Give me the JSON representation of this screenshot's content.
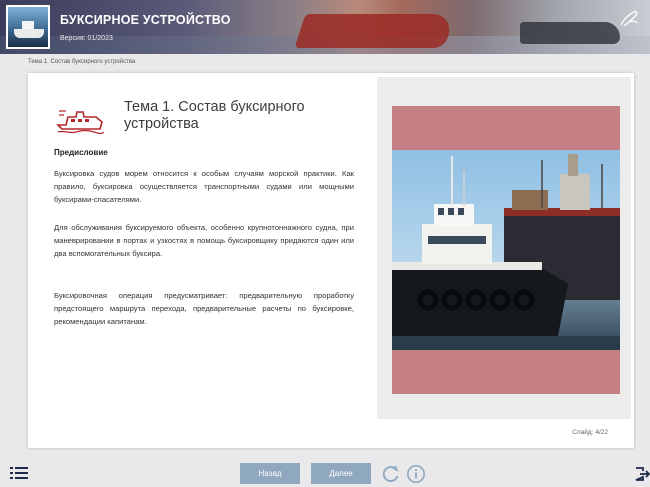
{
  "header": {
    "title": "БУКСИРНОЕ УСТРОЙСТВО",
    "version": "Версия: 01/2023",
    "logo_icon": "tugboat-logo-icon",
    "corner_icon": "signature-icon"
  },
  "breadcrumb": "Тема 1. Состав буксирного устройства",
  "content": {
    "topic_icon": "tugboat-icon",
    "topic_title": "Тема 1. Состав буксирного устройства",
    "section_title": "Предисловие",
    "paragraphs": [
      "Буксировка судов морем относится к особым случаям морской практики. Как правило, буксировка осуществляется транспортными судами или мощными буксирами-спасателями.",
      "Для обслуживания буксируемого объекта, особенно крупнотоннажного судна, при маневрировании в портах и узкостях в помощь буксировщику придаются один или два вспомогательных буксира.",
      "Буксировочная операция предусматривает: предварительную проработку предстоящего маршрута перехода, предварительные расчеты по буксировке, рекомендации капитанам."
    ],
    "image": "tugboat-photo",
    "slide_counter": "Слайд: 4/22"
  },
  "footer": {
    "menu_icon": "menu-list-icon",
    "back_label": "Назад",
    "next_label": "Далее",
    "reload_icon": "reload-icon",
    "info_icon": "info-icon",
    "exit_icon": "exit-icon"
  },
  "colors": {
    "accent_red": "#b3262a",
    "button_blue": "#8fa8c0",
    "image_frame": "#c48082"
  }
}
